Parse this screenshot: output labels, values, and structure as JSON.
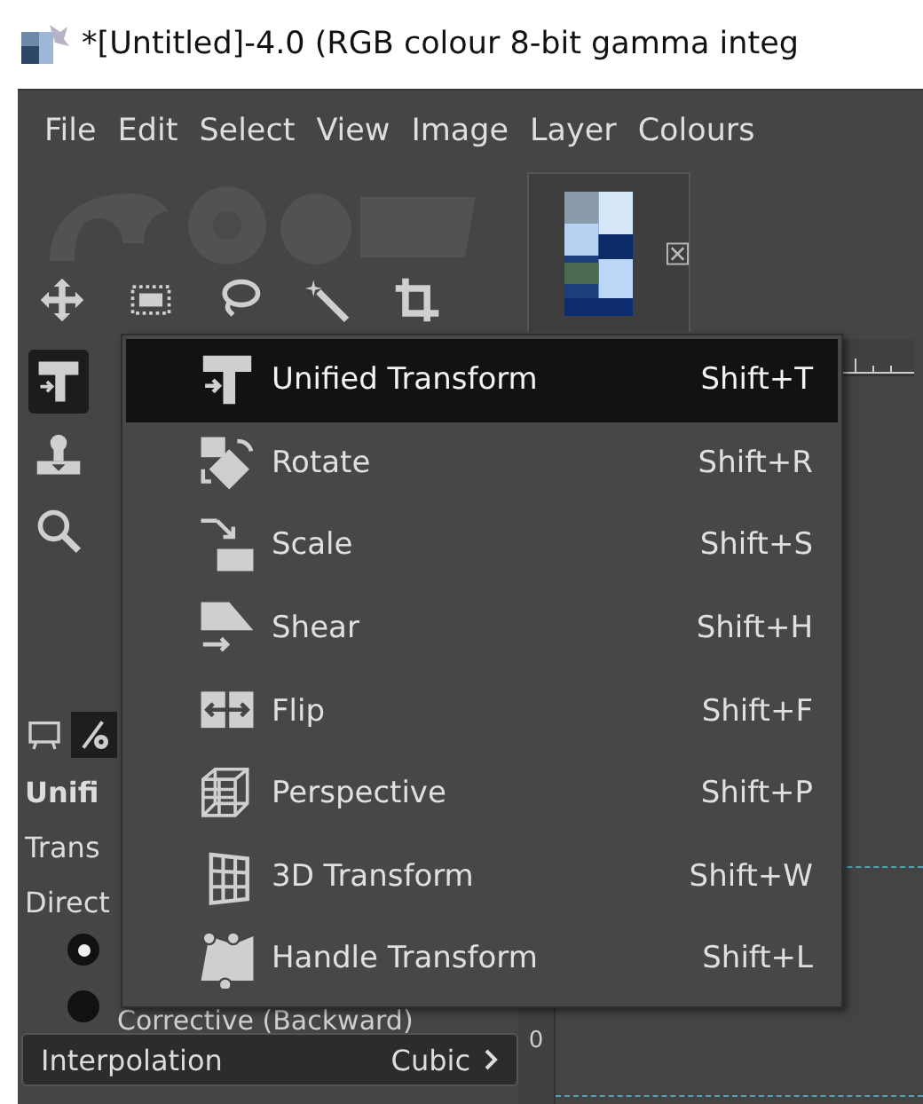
{
  "window": {
    "title": "*[Untitled]-4.0 (RGB colour 8-bit gamma integ"
  },
  "menubar": [
    "File",
    "Edit",
    "Select",
    "View",
    "Image",
    "Layer",
    "Colours"
  ],
  "toolbox": {
    "tool_row": [
      {
        "kind": "move",
        "selected": false
      },
      {
        "kind": "rect-select",
        "selected": false
      },
      {
        "kind": "lasso",
        "selected": false
      },
      {
        "kind": "wand",
        "selected": false
      },
      {
        "kind": "crop",
        "selected": false
      }
    ],
    "tool_column": [
      {
        "kind": "unified",
        "selected": true
      },
      {
        "kind": "puppet",
        "selected": false
      },
      {
        "kind": "zoom",
        "selected": false
      }
    ]
  },
  "image_tab": {
    "kind": "picture"
  },
  "tool_options": {
    "tabs": [
      {
        "kind": "device",
        "selected": false
      },
      {
        "kind": "options",
        "selected": true
      }
    ],
    "title": "Unifi",
    "lines": [
      "Trans",
      "Direct"
    ],
    "radios": [
      {
        "selected": true
      },
      {
        "selected": false,
        "label": "Corrective (Backward)"
      }
    ],
    "interpolation": {
      "label": "Interpolation",
      "value": "Cubic"
    }
  },
  "canvas": {
    "ruler_label": "0"
  },
  "popup_menu": {
    "items": [
      {
        "kind": "unified",
        "label": "Unified Transform",
        "shortcut": "Shift+T",
        "selected": true
      },
      {
        "kind": "rotate",
        "label": "Rotate",
        "shortcut": "Shift+R",
        "selected": false
      },
      {
        "kind": "scale",
        "label": "Scale",
        "shortcut": "Shift+S",
        "selected": false
      },
      {
        "kind": "shear",
        "label": "Shear",
        "shortcut": "Shift+H",
        "selected": false
      },
      {
        "kind": "flip",
        "label": "Flip",
        "shortcut": "Shift+F",
        "selected": false
      },
      {
        "kind": "perspective",
        "label": "Perspective",
        "shortcut": "Shift+P",
        "selected": false
      },
      {
        "kind": "grid",
        "label": "3D Transform",
        "shortcut": "Shift+W",
        "selected": false
      },
      {
        "kind": "handle",
        "label": "Handle Transform",
        "shortcut": "Shift+L",
        "selected": false
      }
    ]
  }
}
